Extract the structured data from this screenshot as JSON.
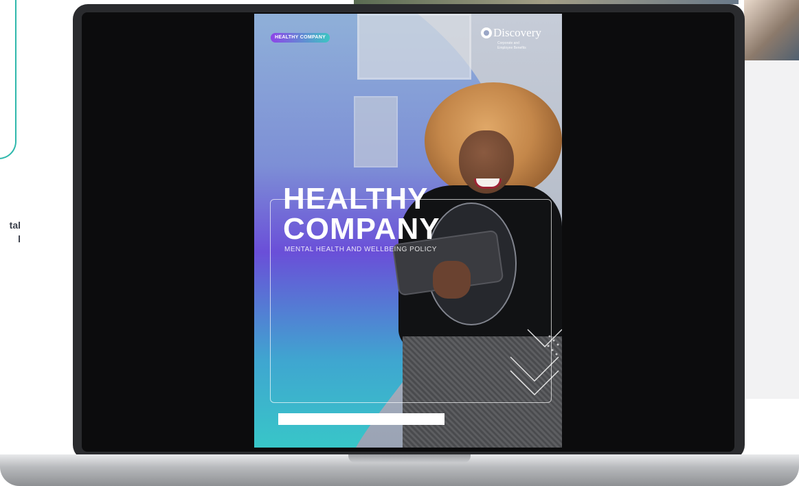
{
  "left_partial_text": {
    "line1": "tal",
    "line2": "l",
    "line3": "/."
  },
  "cover": {
    "badge": "HEALTHY COMPANY",
    "logo": {
      "name": "Discovery",
      "sub_line1": "Corporate and",
      "sub_line2": "Employee Benefits"
    },
    "title_line1": "HEALTHY",
    "title_line2": "COMPANY",
    "subtitle": "MENTAL HEALTH AND WELLBEING POLICY"
  },
  "colors": {
    "accent_teal": "#2fb8ac",
    "badge_start": "#8e44e8",
    "badge_end": "#3cc6c2"
  }
}
